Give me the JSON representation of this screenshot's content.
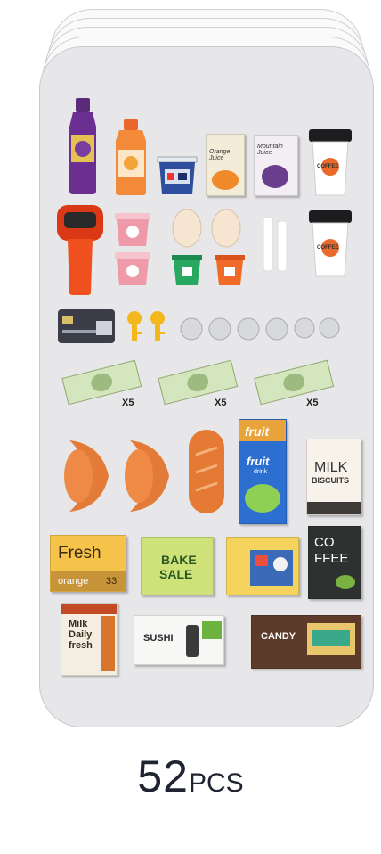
{
  "caption": {
    "count": "52",
    "unit": "PCS"
  },
  "drinks": {
    "orange_label": "Orange Juice",
    "mountain_label": "Mountain Juice",
    "coffee_label": "COFFEE"
  },
  "money": {
    "multiplier": "X5"
  },
  "fruit_drink": {
    "brand": "fruit",
    "sub": "drink"
  },
  "biscuits": {
    "line1": "MILK",
    "line2": "BISCUITS"
  },
  "fresh": {
    "title": "Fresh",
    "sub": "orange",
    "badge": "33"
  },
  "bake_sale": {
    "line1": "BAKE",
    "line2": "SALE"
  },
  "coffee_box": {
    "line1": "CO",
    "line2": "FFEE"
  },
  "milk_box": {
    "line1": "Milk",
    "line2": "Daily",
    "line3": "fresh"
  },
  "sushi": {
    "label": "SUSHI"
  },
  "candy": {
    "label": "CANDY"
  },
  "colors": {
    "card": "#e7e6e8",
    "orange": "#e8702f",
    "money": "#cfe3b8"
  }
}
